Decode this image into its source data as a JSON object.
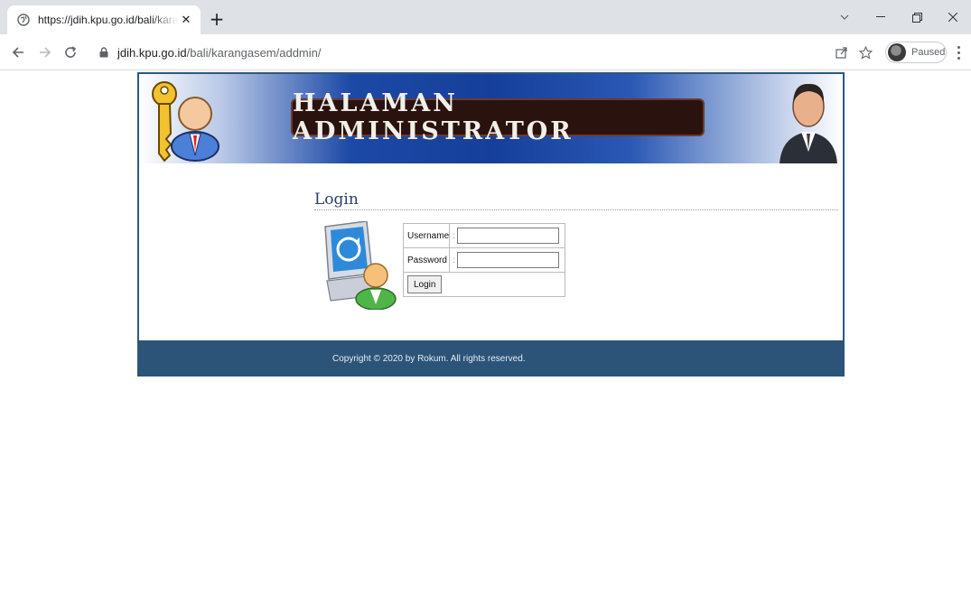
{
  "browser": {
    "tab_title": "https://jdih.kpu.go.id/bali/karangasem",
    "url_host": "jdih.kpu.go.id",
    "url_path": "/bali/karangasem/addmin/",
    "profile_label": "Paused",
    "icons": [
      "globe-icon",
      "close-icon",
      "plus-icon",
      "back-icon",
      "forward-icon",
      "reload-icon",
      "lock-icon",
      "share-icon",
      "star-icon",
      "kebab-menu-icon"
    ]
  },
  "page": {
    "banner_title": "HALAMAN ADMINISTRATOR",
    "login_heading": "Login",
    "form": {
      "username_label": "Username",
      "username_separator": ":",
      "username_value": "",
      "password_label": "Password",
      "password_separator": ":",
      "password_value": "",
      "submit_label": "Login"
    },
    "footer": "Copyright © 2020 by Rokum. All rights reserved.",
    "colors": {
      "banner_blue": "#1d49a6",
      "footer": "#2b5478",
      "border": "#2c5a7f"
    }
  }
}
